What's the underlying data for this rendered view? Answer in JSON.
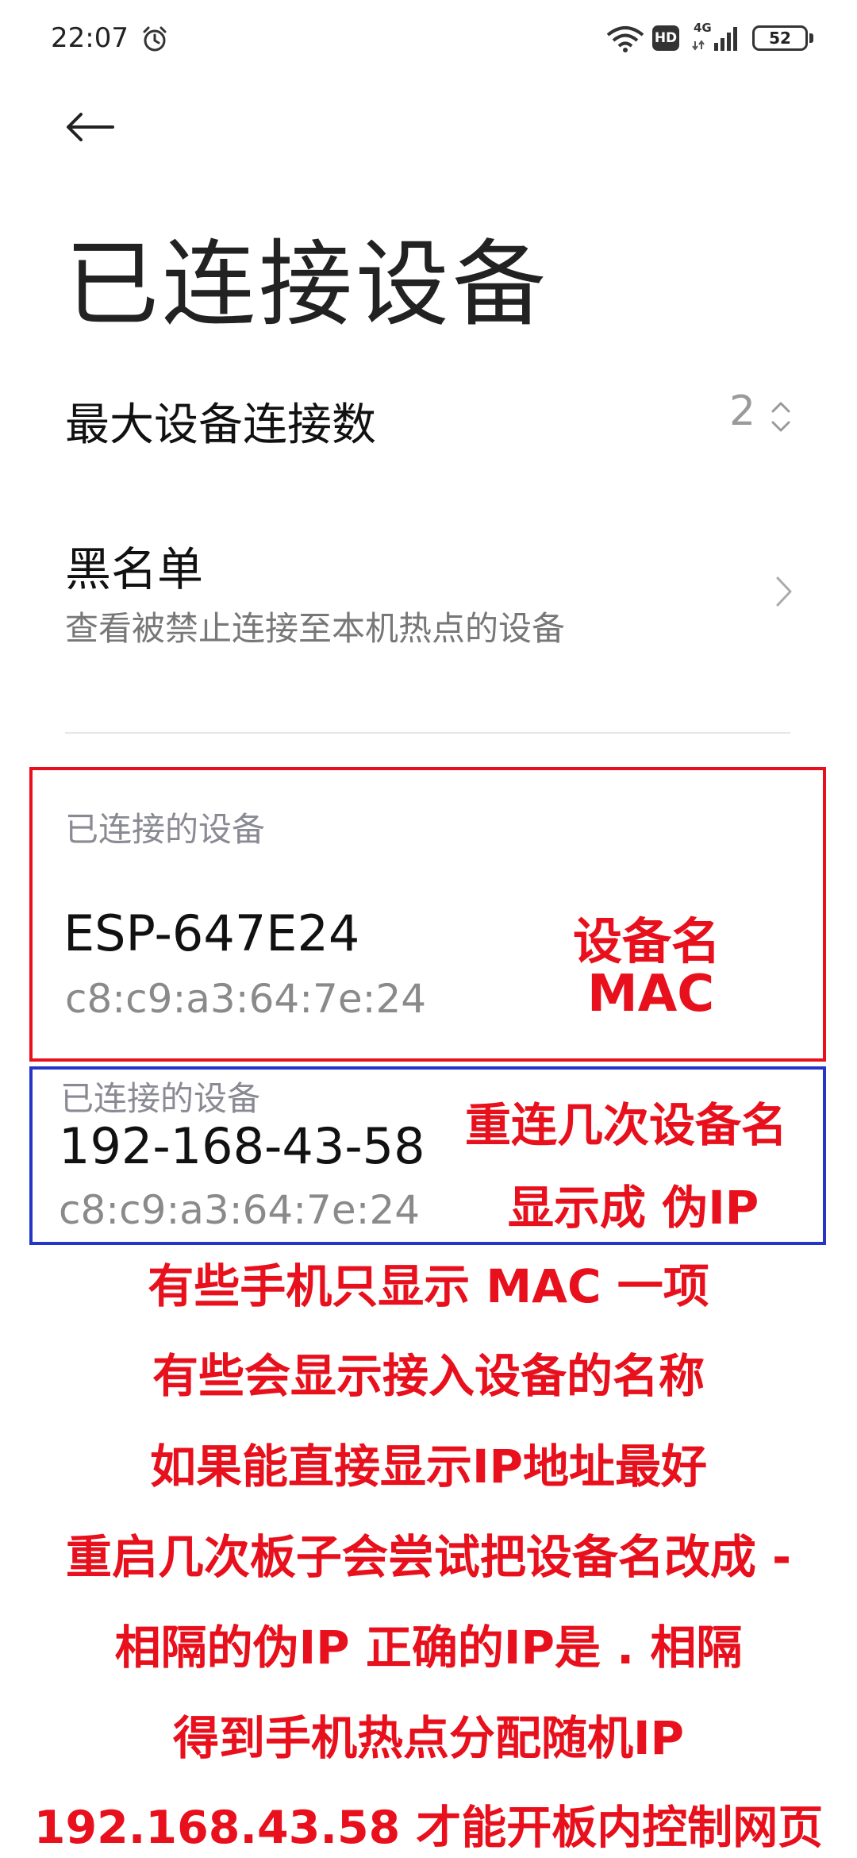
{
  "status_bar": {
    "time": "22:07",
    "hd": "HD",
    "network": "4G",
    "battery": "52"
  },
  "header": {
    "title": "已连接设备"
  },
  "settings": {
    "max_connections_label": "最大设备连接数",
    "max_connections_value": "2",
    "blacklist_label": "黑名单",
    "blacklist_sub": "查看被禁止连接至本机热点的设备"
  },
  "devices": [
    {
      "section_header": "已连接的设备",
      "name": "ESP-647E24",
      "mac": "c8:c9:a3:64:7e:24"
    },
    {
      "section_header": "已连接的设备",
      "name": "192-168-43-58",
      "mac": "c8:c9:a3:64:7e:24"
    }
  ],
  "annotations": {
    "device_name": "设备名",
    "mac": "MAC",
    "reconnect": "重连几次设备名",
    "fake_ip": "显示成 伪IP",
    "notes": [
      "有些手机只显示 MAC 一项",
      "有些会显示接入设备的名称",
      "如果能直接显示IP地址最好",
      "重启几次板子会尝试把设备名改成 -",
      "相隔的伪IP 正确的IP是 . 相隔",
      "得到手机热点分配随机IP",
      "192.168.43.58 才能开板内控制网页"
    ]
  },
  "colors": {
    "annotation_red": "#e8101c",
    "annotation_blue": "#2435c8"
  }
}
